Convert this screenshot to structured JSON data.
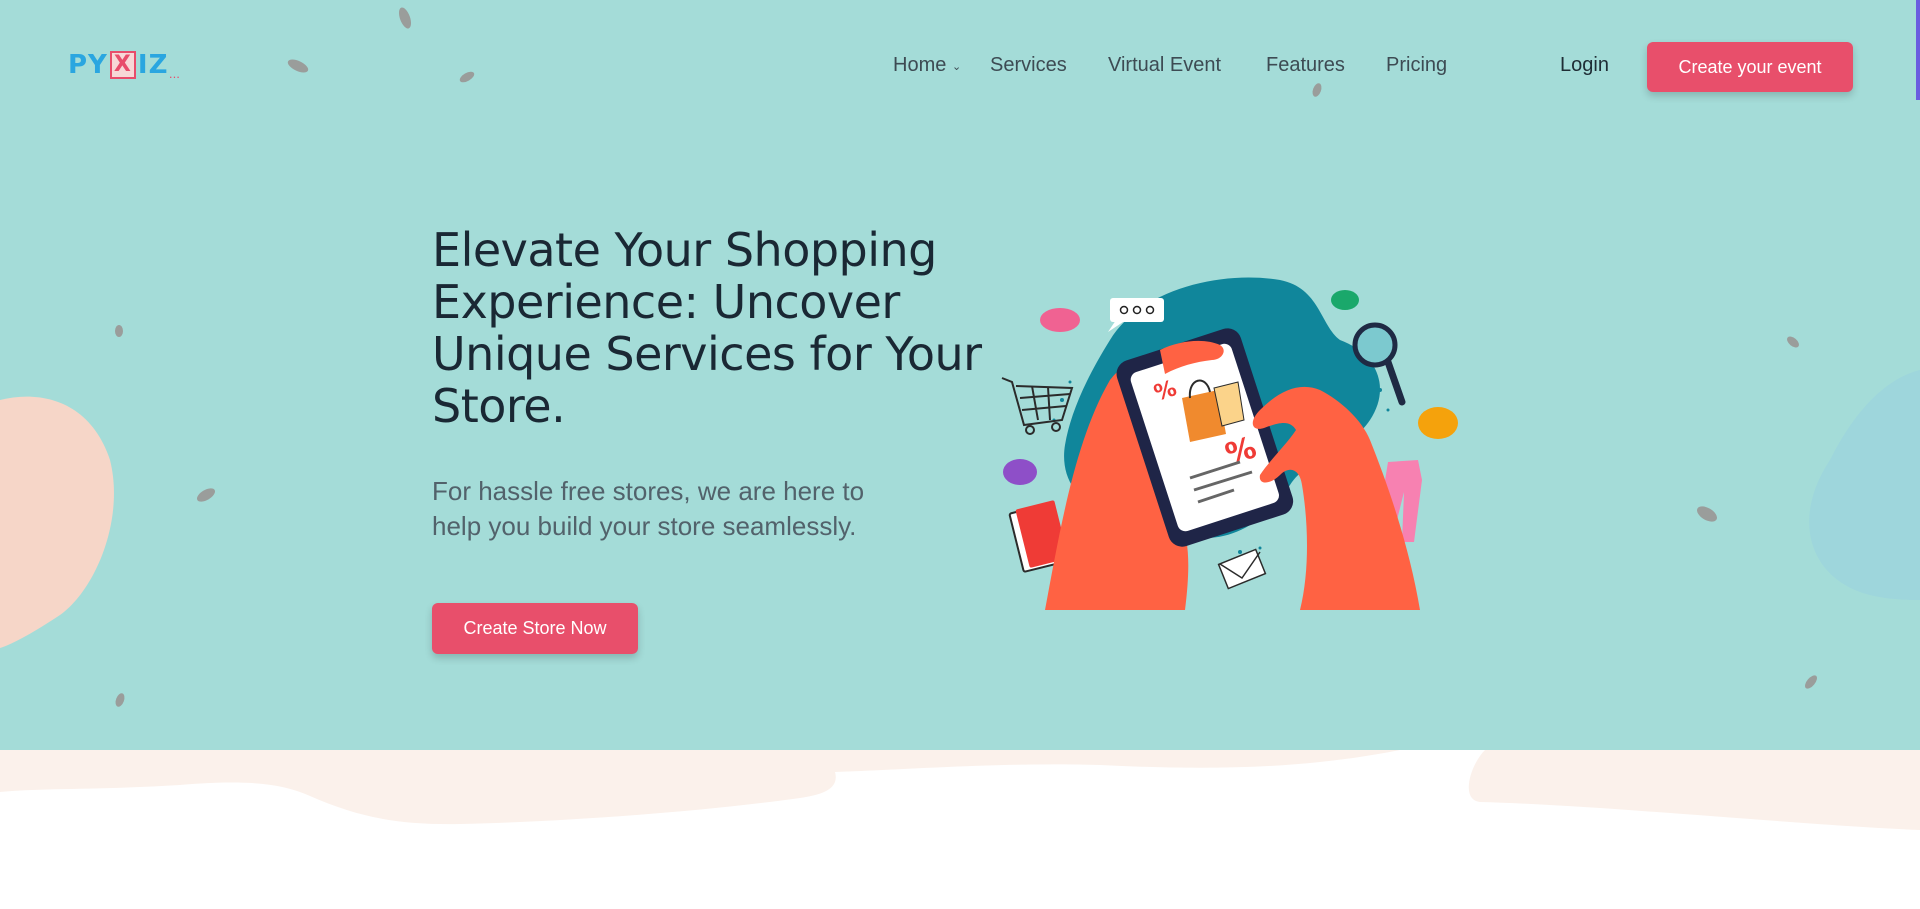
{
  "brand": {
    "logo_prefix": "PY",
    "logo_box": "X",
    "logo_suffix": "IZ",
    "logo_tiny": "..."
  },
  "nav": {
    "items": [
      {
        "label": "Home",
        "has_dropdown": true
      },
      {
        "label": "Services"
      },
      {
        "label": "Virtual Event"
      },
      {
        "label": "Features"
      },
      {
        "label": "Pricing"
      }
    ],
    "login_label": "Login",
    "cta_label": "Create your event"
  },
  "hero": {
    "headline": "Elevate Your Shopping Experience: Uncover Unique Services for Your Store.",
    "subtext": "For hassle free stores, we are here to help you build your store seamlessly.",
    "cta_label": "Create Store Now",
    "illustration": "hands-holding-phone-shopping"
  },
  "colors": {
    "hero_bg": "#a4dcd8",
    "accent": "#e84f6b",
    "text_dark": "#1a2834",
    "text_muted": "#52626b",
    "peach": "#f6d6c8",
    "bottom_wave": "#fbf1eb"
  },
  "icons": [
    "chevron-down-icon",
    "shopping-cart-icon",
    "magnifier-icon",
    "chat-bubble-icon",
    "envelope-icon",
    "shopping-bag-icon",
    "pants-icon",
    "notebook-icon"
  ]
}
